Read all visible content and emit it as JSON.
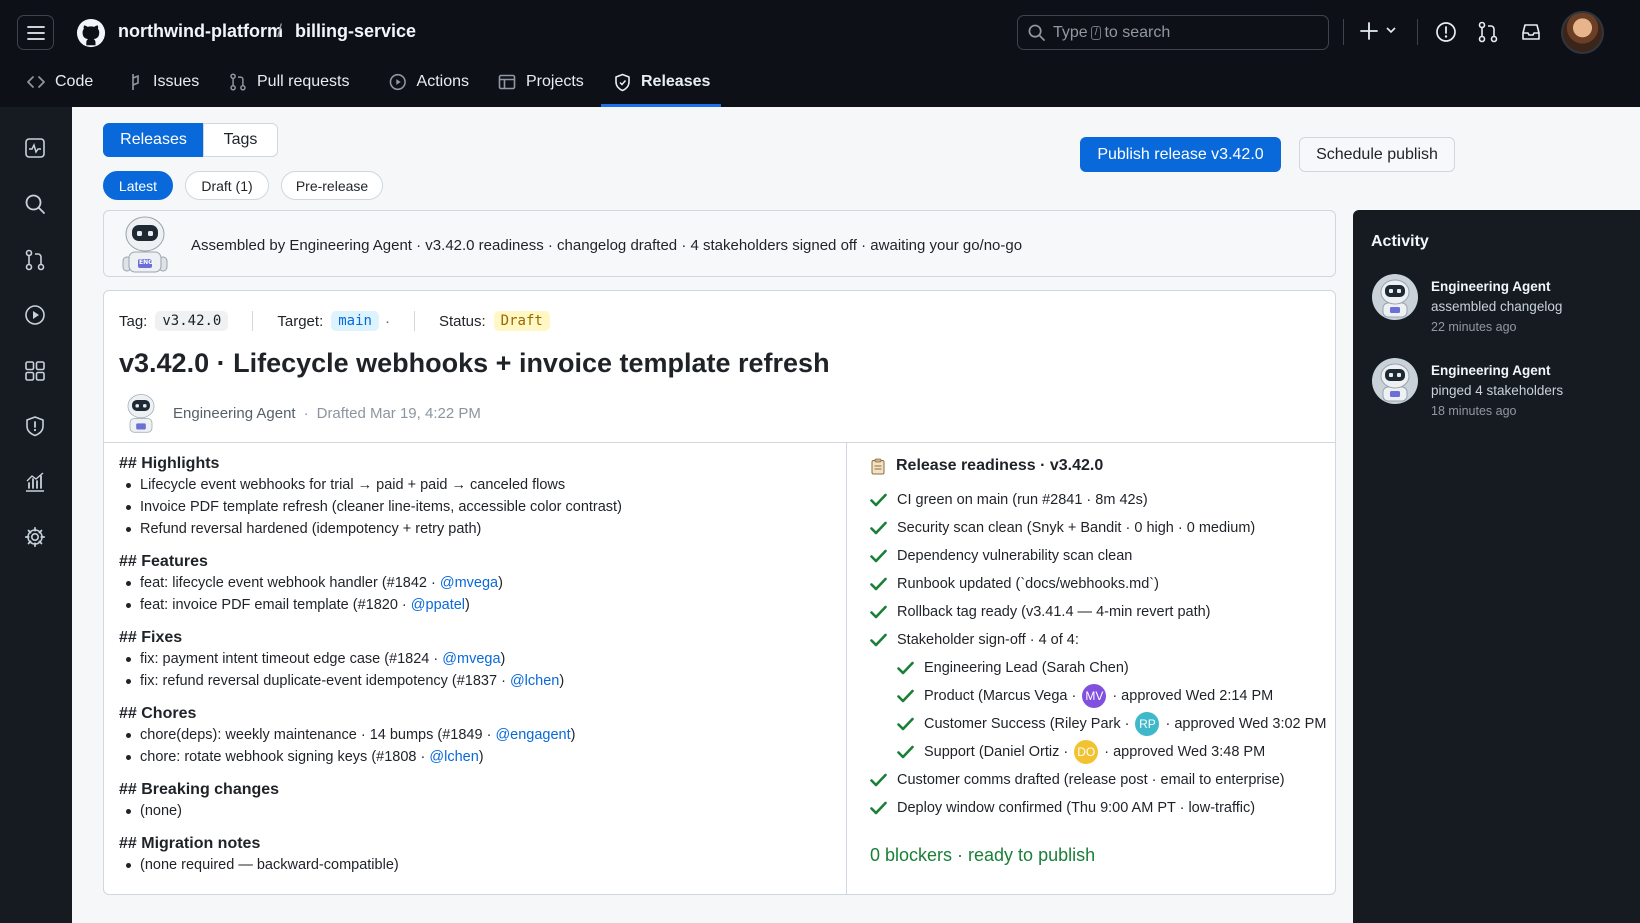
{
  "header": {
    "owner": "northwind-platform",
    "repo": "billing-service",
    "separator": "/",
    "search_prefix": "Type",
    "search_key": "/",
    "search_suffix": "to search",
    "plus_label": "+"
  },
  "nav": {
    "tabs": [
      {
        "label": "Code"
      },
      {
        "label": "Issues"
      },
      {
        "label": "Pull requests"
      },
      {
        "label": "Actions"
      },
      {
        "label": "Projects"
      },
      {
        "label": "Releases"
      }
    ],
    "active": "Releases"
  },
  "toolbar": {
    "segments": [
      "Releases",
      "Tags"
    ],
    "filters": [
      "Latest",
      "Draft (1)",
      "Pre-release"
    ],
    "publish_label": "Publish release v3.42.0",
    "schedule_label": "Schedule publish"
  },
  "banner": {
    "avatar_text": "ENG",
    "text": "Assembled by Engineering Agent  ·  v3.42.0 readiness  ·  changelog drafted  ·  4 stakeholders signed off · awaiting your go/no-go"
  },
  "release": {
    "tag_label": "Tag:",
    "tag": "v3.42.0",
    "target_label": "Target:",
    "target": "main",
    "target_trail": "·",
    "status_label": "Status:",
    "status": "Draft",
    "title": "v3.42.0  ·  Lifecycle webhooks + invoice template refresh",
    "author": "Engineering Agent",
    "dot": "·",
    "drafted": "Drafted Mar 19, 4:22 PM",
    "notes": {
      "highlights": {
        "heading": "## Highlights",
        "items": [
          "Lifecycle event webhooks for trial → paid + paid → canceled flows",
          "Invoice PDF template refresh (cleaner line-items, accessible color contrast)",
          "Refund reversal hardened (idempotency + retry path)"
        ]
      },
      "features": {
        "heading": "## Features",
        "items": [
          {
            "text": "feat: lifecycle event webhook handler (#1842 · ",
            "mention": "@mvega",
            "close": ")"
          },
          {
            "text": "feat: invoice PDF email template (#1820 · ",
            "mention": "@ppatel",
            "close": ")"
          }
        ]
      },
      "fixes": {
        "heading": "## Fixes",
        "items": [
          {
            "text": "fix: payment intent timeout edge case (#1824 · ",
            "mention": "@mvega",
            "close": ")"
          },
          {
            "text": "fix: refund reversal duplicate-event idempotency (#1837 · ",
            "mention": "@lchen",
            "close": ")"
          }
        ]
      },
      "chores": {
        "heading": "## Chores",
        "items": [
          {
            "text": "chore(deps): weekly maintenance · 14 bumps (#1849 · ",
            "mention": "@engagent",
            "close": ")"
          },
          {
            "text": "chore: rotate webhook signing keys (#1808 · ",
            "mention": "@lchen",
            "close": ")"
          }
        ]
      },
      "breaking": {
        "heading": "## Breaking changes",
        "items": [
          "(none)"
        ]
      },
      "migration": {
        "heading": "## Migration notes",
        "items": [
          "(none required — backward-compatible)"
        ]
      }
    }
  },
  "readiness": {
    "title": "Release readiness · v3.42.0",
    "items": [
      "CI green on main (run #2841 · 8m 42s)",
      "Security scan clean (Snyk + Bandit · 0 high · 0 medium)",
      "Dependency vulnerability scan clean",
      "Runbook updated (`docs/webhooks.md`)",
      "Rollback tag ready (v3.41.4 — 4-min revert path)",
      "Stakeholder sign-off · 4 of 4:"
    ],
    "signoffs": [
      {
        "text": "Engineering Lead (Sarah Chen)"
      },
      {
        "text": "Product (Marcus Vega  ·",
        "initials": "MV",
        "color": "#8250df",
        "approved": "· approved Wed 2:14 PM"
      },
      {
        "text": "Customer Success (Riley Park ·",
        "initials": "RP",
        "color": "#3fb9c9",
        "approved": "· approved Wed 3:02 PM"
      },
      {
        "text": "Support (Daniel Ortiz  ·",
        "initials": "DO",
        "color": "#f2c230",
        "approved": "· approved Wed 3:48 PM"
      }
    ],
    "tail_items": [
      "Customer comms drafted (release post · email to enterprise)",
      "Deploy window confirmed (Thu 9:00 AM PT · low-traffic)"
    ],
    "summary": "0 blockers  ·  ready to publish"
  },
  "activity": {
    "title": "Activity",
    "items": [
      {
        "who": "Engineering Agent",
        "what": "assembled changelog",
        "when": "22 minutes ago"
      },
      {
        "who": "Engineering Agent",
        "what": "pinged 4 stakeholders",
        "when": "18 minutes ago"
      }
    ]
  },
  "colors": {
    "accent": "#0969da",
    "success": "#1a7f37",
    "topbar": "#0d1117"
  }
}
